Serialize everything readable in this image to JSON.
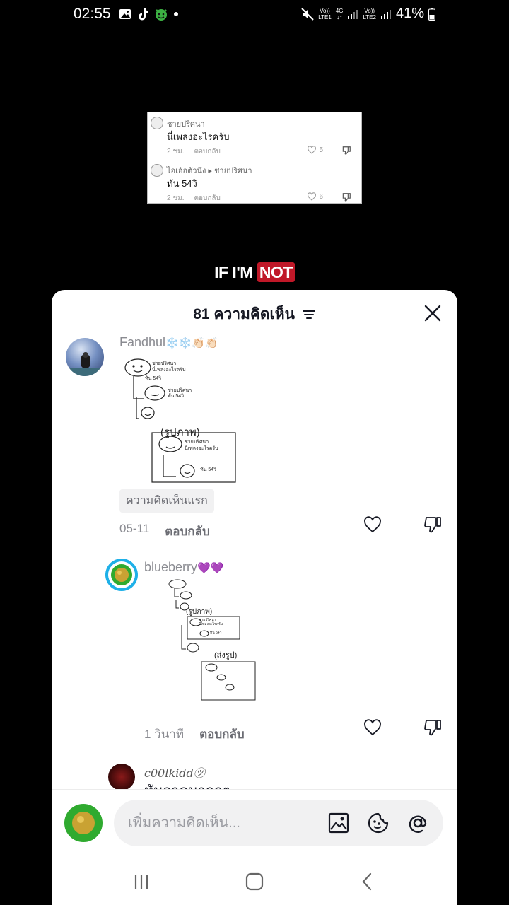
{
  "status_bar": {
    "time": "02:55",
    "network_1_top": "Vo))",
    "network_1_bottom": "LTE1",
    "network_4g": "4G",
    "network_2_top": "Vo))",
    "network_2_bottom": "LTE2",
    "battery": "41%"
  },
  "video_overlay": {
    "card": {
      "comment1_name": "ชายปริศนา",
      "comment1_text": "นี่เพลงอะไรครับ",
      "comment1_time": "2 ชม.",
      "comment1_reply": "ตอบกลับ",
      "comment1_likes": "5",
      "comment2_name": "ไอเอ้อตัวนึง ▸ ชายปริศนา",
      "comment2_text": "ทัน 54วิ",
      "comment2_time": "2 ชม.",
      "comment2_reply": "ตอบกลับ",
      "comment2_likes": "6"
    },
    "caption_text": "IF I'M",
    "caption_highlight": "NOT"
  },
  "comments_sheet": {
    "title": "81 ความคิดเห็น",
    "comments": [
      {
        "username": "Fandhul",
        "emojis": "❄️❄️👏🏻👏🏻",
        "badge": "ความคิดเห็นแรก",
        "time": "05-11",
        "reply_label": "ตอบกลับ"
      },
      {
        "username": "blueberry",
        "emojis": "💜💜",
        "time": "1 วินาที",
        "reply_label": "ตอบกลับ"
      },
      {
        "username": "c00lkidd㋡",
        "partial_text": "หันวาดมากกๆ"
      }
    ],
    "input": {
      "placeholder": "เพิ่มความคิดเห็น..."
    }
  },
  "sketch_labels": {
    "name": "ชายปริศนา",
    "q": "นี่เพลงอะไรครับ",
    "ans": "ทัน 54วิ",
    "img": "(รูปภาพ)",
    "img2": "(ส่งรูป)"
  },
  "colors": {
    "background": "#000000",
    "sheet": "#ffffff",
    "caption_highlight": "#c01828",
    "muted_text": "#8a8b91"
  }
}
